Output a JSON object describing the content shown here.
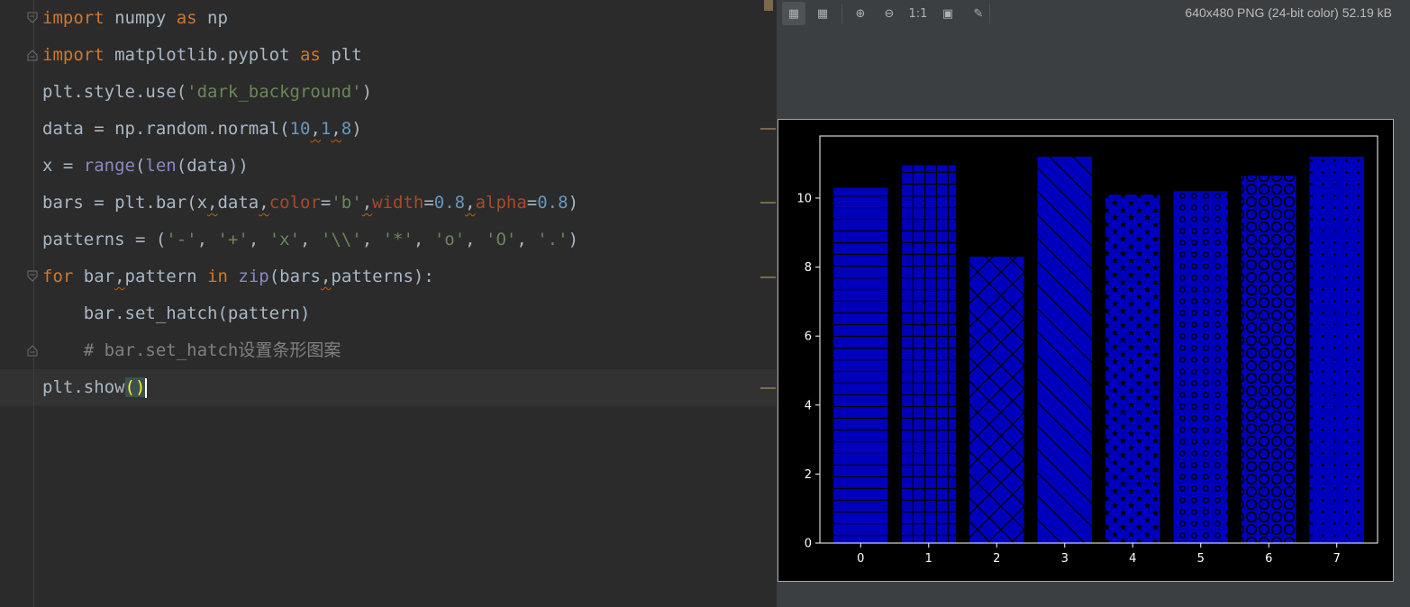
{
  "editor": {
    "lines": [
      {
        "tokens": [
          {
            "t": "import",
            "c": "kw"
          },
          {
            "t": " numpy ",
            "c": ""
          },
          {
            "t": "as",
            "c": "kw"
          },
          {
            "t": " np",
            "c": ""
          }
        ]
      },
      {
        "tokens": [
          {
            "t": "import",
            "c": "kw"
          },
          {
            "t": " matplotlib.pyplot ",
            "c": ""
          },
          {
            "t": "as",
            "c": "kw"
          },
          {
            "t": " plt",
            "c": ""
          }
        ]
      },
      {
        "tokens": [
          {
            "t": "plt.style.use(",
            "c": ""
          },
          {
            "t": "'dark_background'",
            "c": "str"
          },
          {
            "t": ")",
            "c": ""
          }
        ]
      },
      {
        "tokens": [
          {
            "t": "data = np.random.normal(",
            "c": ""
          },
          {
            "t": "10",
            "c": "num"
          },
          {
            "t": ",",
            "c": "squig"
          },
          {
            "t": "1",
            "c": "num"
          },
          {
            "t": ",",
            "c": "squig"
          },
          {
            "t": "8",
            "c": "num"
          },
          {
            "t": ")",
            "c": ""
          }
        ]
      },
      {
        "tokens": [
          {
            "t": "x = ",
            "c": ""
          },
          {
            "t": "range",
            "c": "builtin"
          },
          {
            "t": "(",
            "c": ""
          },
          {
            "t": "len",
            "c": "builtin"
          },
          {
            "t": "(data))",
            "c": ""
          }
        ]
      },
      {
        "tokens": [
          {
            "t": "bars = plt.bar(x",
            "c": ""
          },
          {
            "t": ",",
            "c": "squig"
          },
          {
            "t": "data",
            "c": ""
          },
          {
            "t": ",",
            "c": "squig"
          },
          {
            "t": "color",
            "c": "param"
          },
          {
            "t": "=",
            "c": ""
          },
          {
            "t": "'b'",
            "c": "str"
          },
          {
            "t": ",",
            "c": "squig"
          },
          {
            "t": "width",
            "c": "param"
          },
          {
            "t": "=",
            "c": ""
          },
          {
            "t": "0.8",
            "c": "num"
          },
          {
            "t": ",",
            "c": "squig"
          },
          {
            "t": "alpha",
            "c": "param"
          },
          {
            "t": "=",
            "c": ""
          },
          {
            "t": "0.8",
            "c": "num"
          },
          {
            "t": ")",
            "c": ""
          }
        ]
      },
      {
        "tokens": [
          {
            "t": "patterns = (",
            "c": ""
          },
          {
            "t": "'-'",
            "c": "str"
          },
          {
            "t": ", ",
            "c": ""
          },
          {
            "t": "'+'",
            "c": "str"
          },
          {
            "t": ", ",
            "c": ""
          },
          {
            "t": "'x'",
            "c": "str"
          },
          {
            "t": ", ",
            "c": ""
          },
          {
            "t": "'\\\\'",
            "c": "str"
          },
          {
            "t": ", ",
            "c": ""
          },
          {
            "t": "'*'",
            "c": "str"
          },
          {
            "t": ", ",
            "c": ""
          },
          {
            "t": "'o'",
            "c": "str"
          },
          {
            "t": ", ",
            "c": ""
          },
          {
            "t": "'O'",
            "c": "str"
          },
          {
            "t": ", ",
            "c": ""
          },
          {
            "t": "'.'",
            "c": "str"
          },
          {
            "t": ")",
            "c": ""
          }
        ]
      },
      {
        "tokens": [
          {
            "t": "for",
            "c": "kw"
          },
          {
            "t": " bar",
            "c": ""
          },
          {
            "t": ",",
            "c": "squig"
          },
          {
            "t": "pattern ",
            "c": ""
          },
          {
            "t": "in",
            "c": "kw"
          },
          {
            "t": " ",
            "c": ""
          },
          {
            "t": "zip",
            "c": "builtin"
          },
          {
            "t": "(bars",
            "c": ""
          },
          {
            "t": ",",
            "c": "squig"
          },
          {
            "t": "patterns):",
            "c": ""
          }
        ]
      },
      {
        "tokens": [
          {
            "t": "    bar.set_hatch(pattern)",
            "c": ""
          }
        ]
      },
      {
        "tokens": [
          {
            "t": "    # bar.set_hatch设置条形图案",
            "c": "comment"
          }
        ]
      },
      {
        "tokens": [
          {
            "t": "plt.show",
            "c": ""
          },
          {
            "t": "(",
            "c": "brace-hl"
          },
          {
            "t": ")",
            "c": "brace-hl"
          }
        ]
      }
    ]
  },
  "viewer": {
    "image_info": "640x480 PNG (24-bit color) 52.19 kB",
    "toolbar": [
      {
        "icon": "chessboard-icon",
        "glyph": "▦",
        "active": true
      },
      {
        "icon": "grid-icon",
        "glyph": "▦",
        "active": false
      },
      {
        "icon": "zoom-in-icon",
        "glyph": "⊕",
        "active": false
      },
      {
        "icon": "zoom-out-icon",
        "glyph": "⊖",
        "active": false
      },
      {
        "icon": "actual-size-icon",
        "glyph": "1:1",
        "active": false
      },
      {
        "icon": "fit-zoom-icon",
        "glyph": "▣",
        "active": false
      },
      {
        "icon": "color-picker-icon",
        "glyph": "✎",
        "active": false
      }
    ]
  },
  "chart_data": {
    "type": "bar",
    "categories": [
      "0",
      "1",
      "2",
      "3",
      "4",
      "5",
      "6",
      "7"
    ],
    "values": [
      10.3,
      10.95,
      8.3,
      11.2,
      10.1,
      10.2,
      10.65,
      11.2
    ],
    "hatches": [
      "-",
      "+",
      "x",
      "\\",
      "*",
      "o",
      "O",
      "."
    ],
    "ylim": [
      0,
      11.8
    ],
    "yticks": [
      0,
      2,
      4,
      6,
      8,
      10
    ],
    "color": "#0000cc",
    "title": "",
    "xlabel": "",
    "ylabel": ""
  }
}
